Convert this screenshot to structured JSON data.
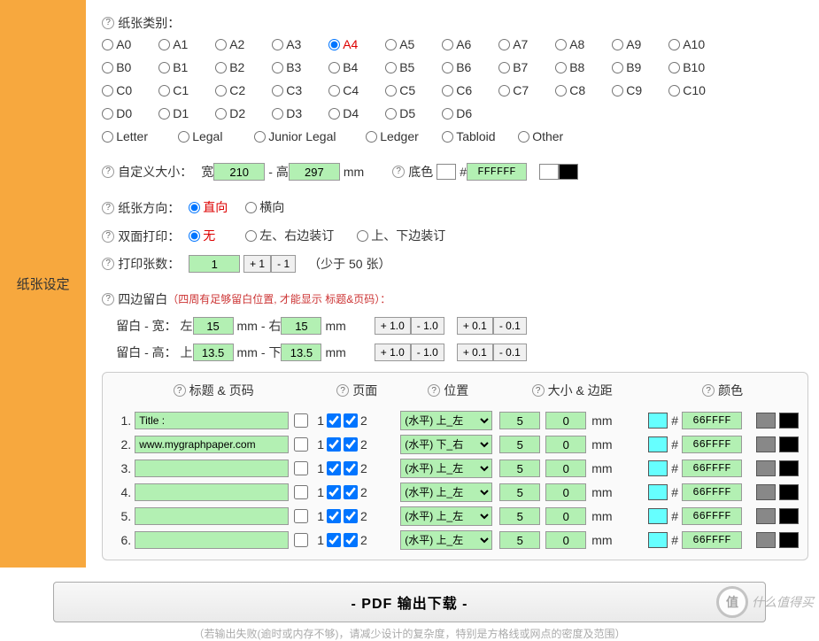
{
  "sidebar": {
    "title": "纸张设定"
  },
  "paper_type": {
    "label": "纸张类别：",
    "rows": [
      [
        "A0",
        "A1",
        "A2",
        "A3",
        "A4",
        "A5",
        "A6",
        "A7",
        "A8",
        "A9",
        "A10"
      ],
      [
        "B0",
        "B1",
        "B2",
        "B3",
        "B4",
        "B5",
        "B6",
        "B7",
        "B8",
        "B9",
        "B10"
      ],
      [
        "C0",
        "C1",
        "C2",
        "C3",
        "C4",
        "C5",
        "C6",
        "C7",
        "C8",
        "C9",
        "C10"
      ],
      [
        "D0",
        "D1",
        "D2",
        "D3",
        "D4",
        "D5",
        "D6"
      ],
      [
        "Letter",
        "Legal",
        "Junior Legal",
        "Ledger",
        "Tabloid",
        "Other"
      ]
    ],
    "selected": "A4"
  },
  "custom_size": {
    "label": "自定义大小：",
    "w_label": "宽",
    "h_label": "高",
    "dash": "-",
    "unit": "mm",
    "width": "210",
    "height": "297"
  },
  "bgcolor": {
    "label": "底色",
    "hash": "#",
    "hex": "FFFFFF",
    "swatch1": "#ffffff",
    "swatch2": "#000000"
  },
  "orientation": {
    "label": "纸张方向：",
    "portrait": "直向",
    "landscape": "横向",
    "selected": "portrait"
  },
  "duplex": {
    "label": "双面打印：",
    "none": "无",
    "lr": "左、右边装订",
    "tb": "上、下边装订",
    "selected": "none"
  },
  "print_count": {
    "label": "打印张数：",
    "value": "1",
    "plus": "+ 1",
    "minus": "-  1",
    "note": "（少于 50 张）"
  },
  "margins": {
    "label": "四边留白",
    "note": "（四周有足够留白位置, 才能显示 标题&页码）：",
    "w_prefix": "留白 - 宽：",
    "left": "左",
    "right": "右",
    "h_prefix": "留白 - 高：",
    "top": "上",
    "bottom": "下",
    "dash": "-",
    "unit": "mm",
    "lv": "15",
    "rv": "15",
    "tv": "13.5",
    "bv": "13.5",
    "btn_p1": "+ 1.0",
    "btn_m1": "- 1.0",
    "btn_p01": "+ 0.1",
    "btn_m01": "- 0.1"
  },
  "header_panel": {
    "h_title": "标题 & 页码",
    "h_page": "页面",
    "h_pos": "位置",
    "h_size": "大小 & 边距",
    "h_color": "颜色",
    "page1": "1",
    "page2": "2",
    "unit": "mm",
    "hash": "#",
    "rows": [
      {
        "n": "1.",
        "title": "Title :",
        "p1": true,
        "p2": true,
        "pos": "(水平) 上_左",
        "s1": "5",
        "s2": "0",
        "hex": "66FFFF",
        "c1": "#66ffff",
        "c2": "#888888",
        "c3": "#000000"
      },
      {
        "n": "2.",
        "title": "www.mygraphpaper.com",
        "p1": true,
        "p2": true,
        "pos": "(水平) 下_右",
        "s1": "5",
        "s2": "0",
        "hex": "66FFFF",
        "c1": "#66ffff",
        "c2": "#888888",
        "c3": "#000000"
      },
      {
        "n": "3.",
        "title": "",
        "p1": true,
        "p2": true,
        "pos": "(水平) 上_左",
        "s1": "5",
        "s2": "0",
        "hex": "66FFFF",
        "c1": "#66ffff",
        "c2": "#888888",
        "c3": "#000000"
      },
      {
        "n": "4.",
        "title": "",
        "p1": true,
        "p2": true,
        "pos": "(水平) 上_左",
        "s1": "5",
        "s2": "0",
        "hex": "66FFFF",
        "c1": "#66ffff",
        "c2": "#888888",
        "c3": "#000000"
      },
      {
        "n": "5.",
        "title": "",
        "p1": true,
        "p2": true,
        "pos": "(水平) 上_左",
        "s1": "5",
        "s2": "0",
        "hex": "66FFFF",
        "c1": "#66ffff",
        "c2": "#888888",
        "c3": "#000000"
      },
      {
        "n": "6.",
        "title": "",
        "p1": true,
        "p2": true,
        "pos": "(水平) 上_左",
        "s1": "5",
        "s2": "0",
        "hex": "66FFFF",
        "c1": "#66ffff",
        "c2": "#888888",
        "c3": "#000000"
      }
    ]
  },
  "download": {
    "label": "- PDF 输出下载 -",
    "footnote": "（若输出失败(逾时或内存不够)，请减少设计的复杂度，特别是方格线或网点的密度及范围）"
  },
  "watermark": {
    "badge": "值",
    "text": "什么值得买"
  }
}
